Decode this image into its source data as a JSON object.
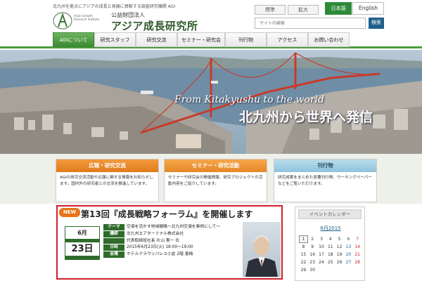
{
  "header": {
    "tagline": "北九州を拠点にアジアの成長と発展に貢献する調査研究機関 AGI",
    "logo_small_text": "Asian Growth Research Institute",
    "org_sub": "公益財団法人",
    "org_name": "アジア成長研究所",
    "font_standard": "標準",
    "font_large": "拡大",
    "lang_japanese": "日本語",
    "lang_english": "English",
    "search_placeholder": "サイト内検索",
    "search_button": "検索"
  },
  "nav": {
    "items": [
      {
        "label": "AGIについて"
      },
      {
        "label": "研究スタッフ"
      },
      {
        "label": "研究交流"
      },
      {
        "label": "セミナー・研究会"
      },
      {
        "label": "刊行物"
      },
      {
        "label": "アクセス"
      },
      {
        "label": "お問い合わせ"
      }
    ]
  },
  "hero": {
    "english": "From Kitakyushu to the world",
    "japanese": "北九州から世界へ発信"
  },
  "cards": [
    {
      "title": "広報・研究交流",
      "body": "AGIの研究交流活動や広報に関する情報をお知らせします。国内外の研究者との交流を推進しています。"
    },
    {
      "title": "セミナー・研究活動",
      "body": "セミナーや研究会の開催情報、研究プロジェクトの活動内容をご紹介しています。"
    },
    {
      "title": "刊行物",
      "body": "研究成果をまとめた各種刊行物、ワーキングペーパーなどをご覧いただけます。"
    }
  ],
  "event": {
    "badge": "NEW",
    "title": "第13回『成長戦略フォーラム』を開催します",
    "month": "6月",
    "day": "23日",
    "rows": [
      {
        "label": "テーマ",
        "value": "空港を活かす地域戦略～北九州空港を事例にして～"
      },
      {
        "label": "講師",
        "value": "北九州エアターミナル株式会社"
      },
      {
        "label": "",
        "value": "代表取締役社長 片山 憲一 氏"
      },
      {
        "label": "日時",
        "value": "2015年6月23日(火) 18:00～19:00"
      },
      {
        "label": "会場",
        "value": "ホテルクラウンパレス小倉 2階 香梅"
      }
    ]
  },
  "calendar": {
    "heading": "イベントカレンダー",
    "month": "6月2015",
    "rows": [
      [
        "1",
        "2",
        "3",
        "4",
        "5",
        "6",
        "7"
      ],
      [
        "8",
        "9",
        "10",
        "11",
        "12",
        "13",
        "14"
      ],
      [
        "15",
        "16",
        "17",
        "18",
        "19",
        "20",
        "21"
      ],
      [
        "22",
        "23",
        "24",
        "25",
        "26",
        "27",
        "28"
      ],
      [
        "29",
        "30",
        "",
        "",
        "",
        "",
        ""
      ]
    ]
  },
  "colors": {
    "brand_green": "#2f6b2a",
    "nav_active": "#4b9b3e",
    "accent_orange": "#e07b1a",
    "event_border": "#d21f2a",
    "link_blue": "#1f5f8b"
  }
}
